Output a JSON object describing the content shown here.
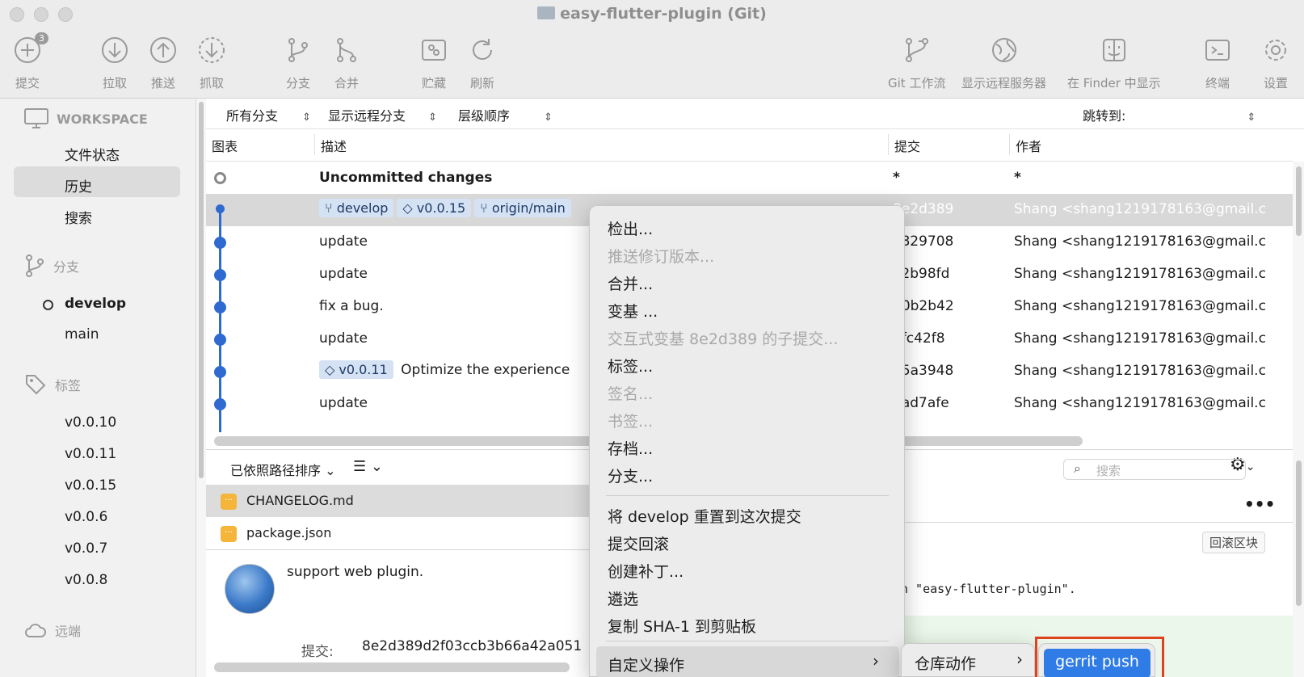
{
  "window": {
    "title": "easy-flutter-plugin (Git)"
  },
  "toolbar": {
    "commit_badge": "3",
    "items": [
      {
        "label": "提交",
        "icon": "commit-plus-icon"
      },
      {
        "label": "拉取",
        "icon": "pull-arrow-down-icon"
      },
      {
        "label": "推送",
        "icon": "push-arrow-up-icon"
      },
      {
        "label": "抓取",
        "icon": "fetch-dashed-arrow-icon"
      },
      {
        "label": "分支",
        "icon": "branch-icon"
      },
      {
        "label": "合并",
        "icon": "merge-icon"
      },
      {
        "label": "贮藏",
        "icon": "stash-box-icon"
      },
      {
        "label": "刷新",
        "icon": "refresh-icon"
      },
      {
        "label": "Git 工作流",
        "icon": "git-flow-icon"
      },
      {
        "label": "显示远程服务器",
        "icon": "globe-icon"
      },
      {
        "label": "在 Finder 中显示",
        "icon": "finder-icon"
      },
      {
        "label": "终端",
        "icon": "terminal-icon"
      },
      {
        "label": "设置",
        "icon": "gear-icon"
      }
    ]
  },
  "sidebar": {
    "workspace_header": "WORKSPACE",
    "workspace_items": [
      "文件状态",
      "历史",
      "搜索"
    ],
    "branches_header": "分支",
    "branches": [
      "develop",
      "main"
    ],
    "tags_header": "标签",
    "tags": [
      "v0.0.10",
      "v0.0.11",
      "v0.0.15",
      "v0.0.6",
      "v0.0.7",
      "v0.0.8"
    ],
    "remotes_header": "远端"
  },
  "filters": {
    "branches": "所有分支",
    "remote": "显示远程分支",
    "order": "层级顺序",
    "jump_to": "跳转到:"
  },
  "table": {
    "headers": {
      "graph": "图表",
      "description": "描述",
      "commit": "提交",
      "author": "作者"
    },
    "uncommitted": {
      "description": "Uncommitted changes",
      "commit": "*",
      "author": "*"
    },
    "selected_row": {
      "chips": [
        "develop",
        "v0.0.15",
        "origin/main"
      ],
      "commit": "8e2d389",
      "author": "Shang <shang1219178163@gmail.c"
    },
    "rows": [
      {
        "description": "update",
        "commit": "e829708",
        "author": "Shang <shang1219178163@gmail.c"
      },
      {
        "description": "update",
        "commit": "a2b98fd",
        "author": "Shang <shang1219178163@gmail.c"
      },
      {
        "description": "fix a bug.",
        "commit": "90b2b42",
        "author": "Shang <shang1219178163@gmail.c"
      },
      {
        "description": "update",
        "commit": "7fc42f8",
        "author": "Shang <shang1219178163@gmail.c"
      },
      {
        "tag": "v0.0.11",
        "description": "Optimize the experience",
        "commit": "85a3948",
        "author": "Shang <shang1219178163@gmail.c"
      },
      {
        "description": "update",
        "commit": "7ad7afe",
        "author": "Shang <shang1219178163@gmail.c"
      }
    ]
  },
  "bottom": {
    "sort_label": "已依照路径排序",
    "search_placeholder": "搜索",
    "files": [
      "CHANGELOG.md",
      "package.json"
    ],
    "file_badge": "···",
    "more_label": "•••",
    "rollback_label": "回滚区块",
    "commit_message": "support web plugin.",
    "commit_label": "提交:",
    "commit_hash": "8e2d389d2f03ccb3b66a42a051",
    "diff_text": "h \"easy-flutter-plugin\"."
  },
  "context_menu": {
    "group1": [
      {
        "label": "检出...",
        "enabled": true
      },
      {
        "label": "推送修订版本...",
        "enabled": false
      },
      {
        "label": "合并...",
        "enabled": true
      },
      {
        "label": "变基 ...",
        "enabled": true
      },
      {
        "label": "交互式变基 8e2d389 的子提交...",
        "enabled": false
      },
      {
        "label": "标签...",
        "enabled": true
      },
      {
        "label": "签名...",
        "enabled": false
      },
      {
        "label": "书签...",
        "enabled": false
      },
      {
        "label": "存档...",
        "enabled": true
      },
      {
        "label": "分支...",
        "enabled": true
      }
    ],
    "group2": [
      {
        "label": "将 develop 重置到这次提交"
      },
      {
        "label": "提交回滚"
      },
      {
        "label": "创建补丁..."
      },
      {
        "label": "遴选"
      },
      {
        "label": "复制 SHA-1 到剪贴板"
      }
    ],
    "custom_actions": "自定义操作",
    "submenu": "仓库动作",
    "action": "gerrit push",
    "highlight_color": "#2f7ce6",
    "annotation_color": "#e0421d"
  }
}
